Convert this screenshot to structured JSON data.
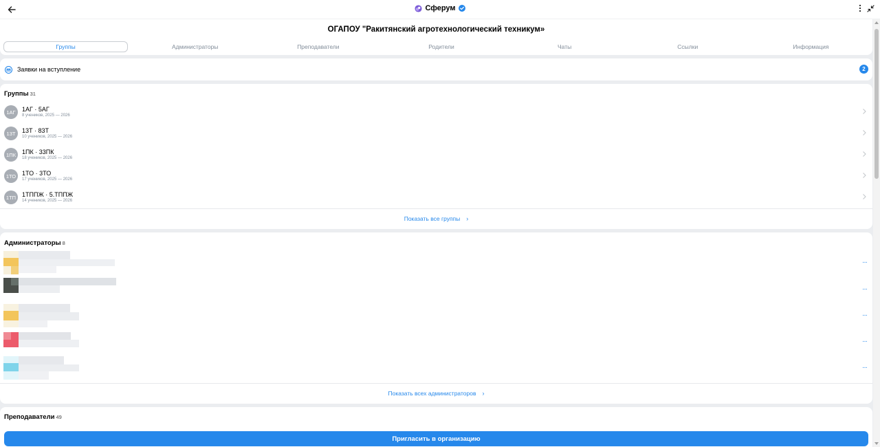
{
  "app": {
    "name": "Сферум"
  },
  "org": {
    "title": "ОГАПОУ \"Ракитянский агротехнологический техникум»"
  },
  "tabs": [
    "Группы",
    "Администраторы",
    "Преподаватели",
    "Родители",
    "Чаты",
    "Ссылки",
    "Информация"
  ],
  "requests": {
    "label": "Заявки на вступление",
    "badge": "2"
  },
  "groups": {
    "title": "Группы",
    "count": "31",
    "items": [
      {
        "avatar": "1АГ",
        "name": "1АГ · 5АГ",
        "sub": "8 учеников, 2025 — 2026"
      },
      {
        "avatar": "13Т",
        "name": "13Т · 83Т",
        "sub": "10 учеников, 2025 — 2026"
      },
      {
        "avatar": "1ПК",
        "name": "1ПК · 33ПК",
        "sub": "18 учеников, 2025 — 2026"
      },
      {
        "avatar": "1ТО",
        "name": "1ТО · 3ТО",
        "sub": "17 учеников, 2025 — 2026"
      },
      {
        "avatar": "1ТП",
        "name": "1ТППЖ · 5.ТППЖ",
        "sub": "14 учеников, 2025 — 2026"
      }
    ],
    "show_all": "Показать все группы"
  },
  "admins": {
    "title": "Администраторы",
    "count": "8",
    "show_all": "Показать всех администраторов",
    "avatar_colors": [
      "#f3c55b",
      "#4a4f4a",
      "#f3c55b",
      "#ec5b6b",
      "#7fd4ea"
    ]
  },
  "teachers": {
    "title": "Преподаватели",
    "count": "49"
  },
  "invite_button": "Пригласить в организацию",
  "colors": {
    "accent": "#2688eb",
    "muted": "#818c99",
    "background": "#ebedf0"
  }
}
